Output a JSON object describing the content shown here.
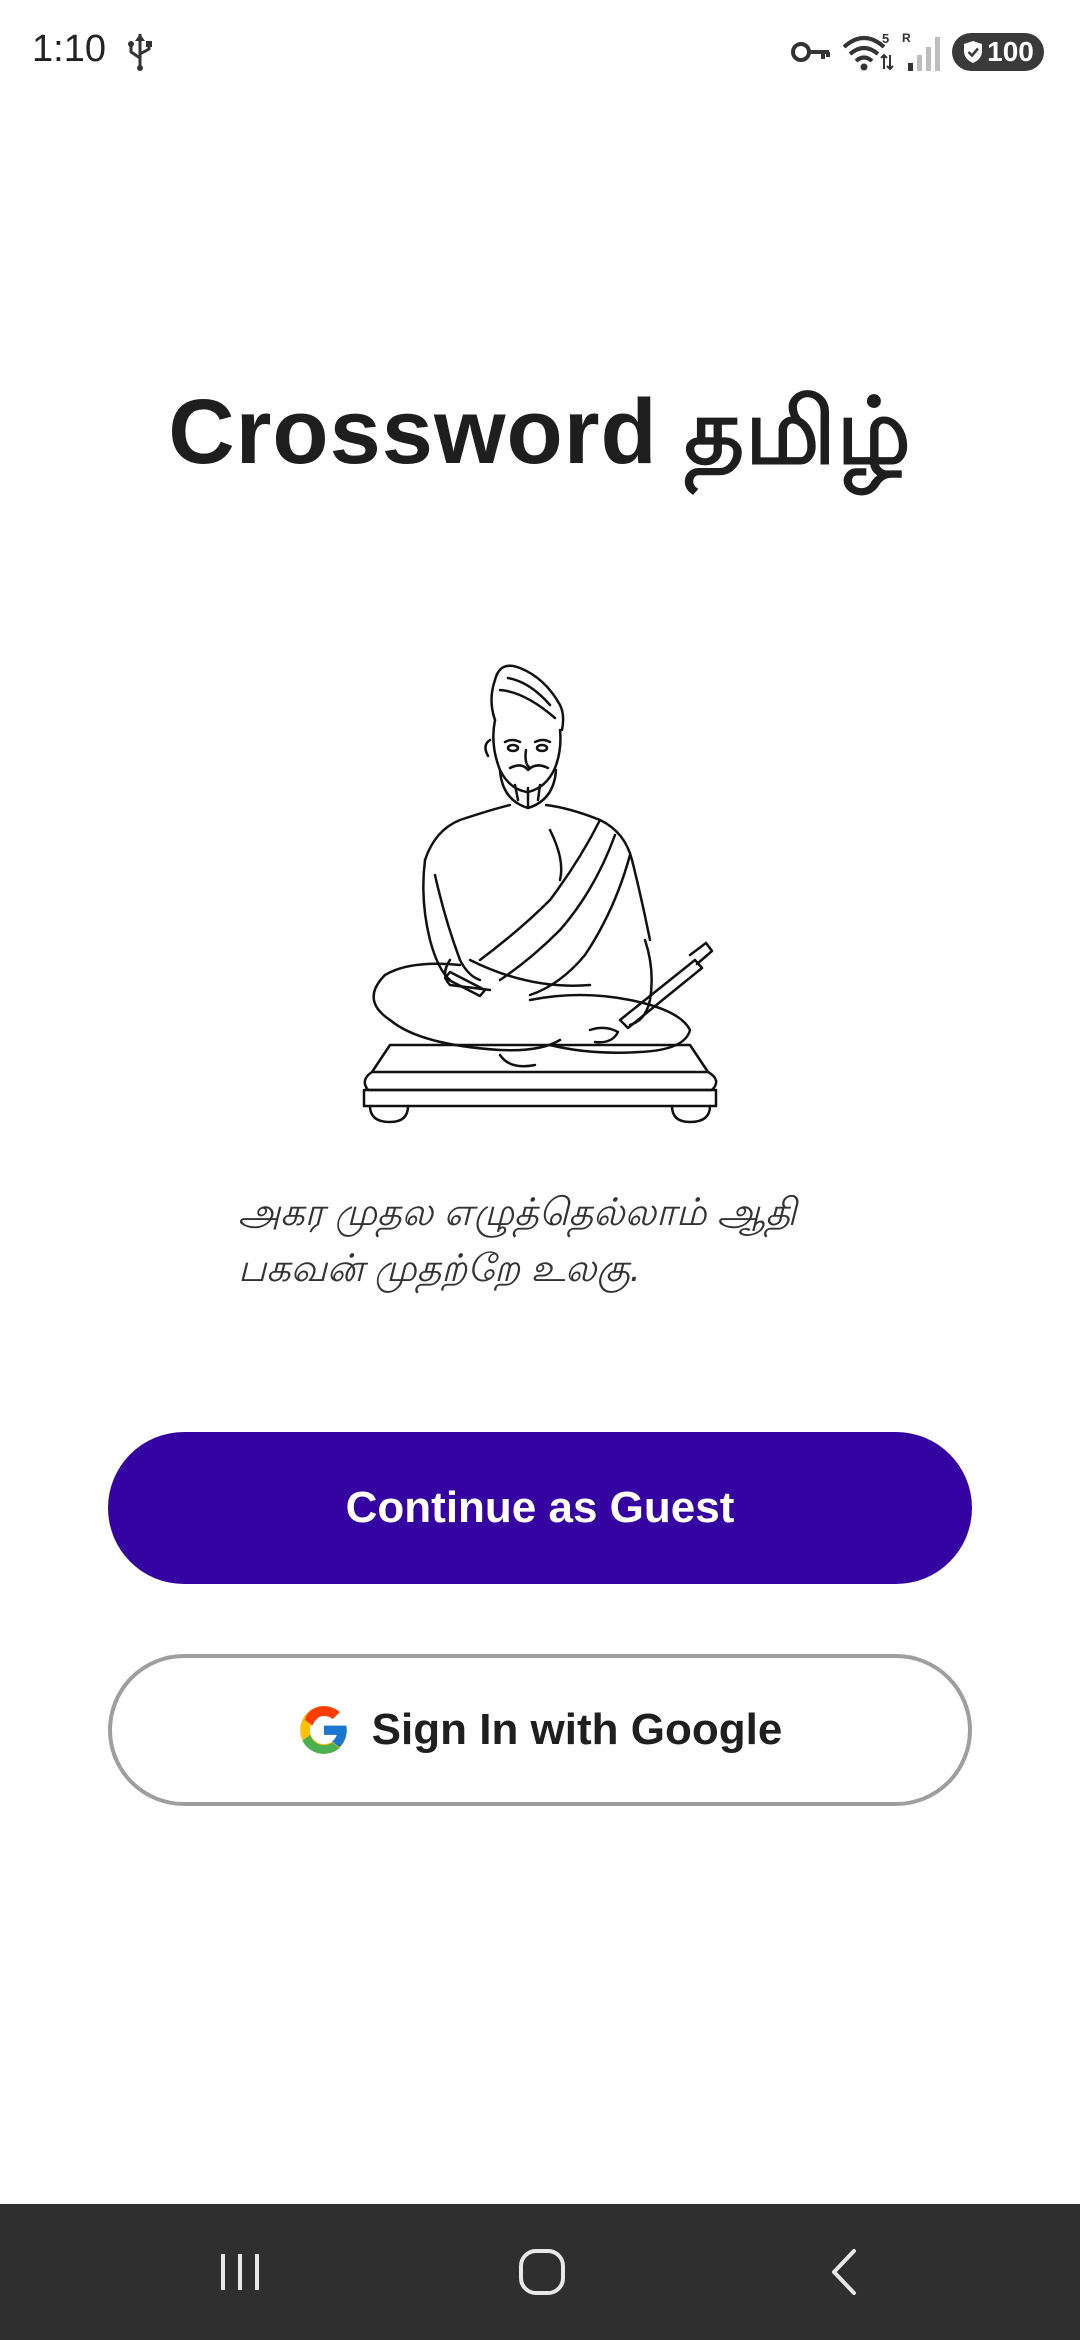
{
  "status_bar": {
    "time": "1:10",
    "battery": "100",
    "icons": [
      "usb-icon",
      "vpn-key-icon",
      "wifi-icon",
      "signal-icon",
      "shield-icon"
    ]
  },
  "app": {
    "title": "Crossword தமிழ்",
    "illustration": "thiruvalluvar-illustration"
  },
  "quote": {
    "line1": "அகர முதல எழுத்தெல்லாம் ஆதி",
    "line2": "பகவன் முதற்றே உலகு."
  },
  "buttons": {
    "guest_label": "Continue as Guest",
    "google_label": "Sign In with Google"
  },
  "colors": {
    "primary": "#3503a1",
    "outline": "#9e9e9e",
    "nav_bar": "#2f2f2f"
  },
  "nav_bar": {
    "icons": [
      "recents-icon",
      "home-icon",
      "back-icon"
    ]
  }
}
